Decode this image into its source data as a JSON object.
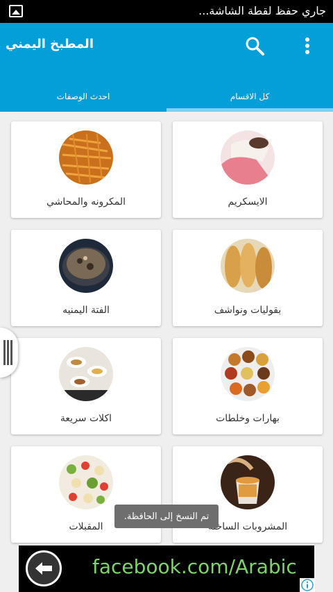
{
  "status_bar": {
    "text": "جاري حفظ لقطة الشاشة..."
  },
  "app": {
    "title": "المطبخ اليمني"
  },
  "tabs": [
    {
      "label": "كل الاقسام",
      "active": true
    },
    {
      "label": "احدث الوصفات",
      "active": false
    }
  ],
  "categories": [
    {
      "label": "الايسكريم",
      "icon": "ice-cream-photo"
    },
    {
      "label": "المكرونه والمحاشي",
      "icon": "pasta-photo"
    },
    {
      "label": "بقوليات ونواشف",
      "icon": "bread-photo"
    },
    {
      "label": "الفتة اليمنيه",
      "icon": "fatta-photo"
    },
    {
      "label": "بهارات وخلطات",
      "icon": "spices-photo"
    },
    {
      "label": "اكلات سريعة",
      "icon": "fast-food-photo"
    },
    {
      "label": "المشروبات الساخنة",
      "icon": "hot-drink-photo"
    },
    {
      "label": "المقبلات",
      "icon": "salad-photo"
    }
  ],
  "toast": {
    "text": "تم النسخ إلى الحافظة."
  },
  "ad": {
    "text": "facebook.com/Arabic"
  },
  "colors": {
    "primary": "#049fd9",
    "tab_indicator": "#7fd1f2",
    "ad_text": "#7ed36a"
  }
}
